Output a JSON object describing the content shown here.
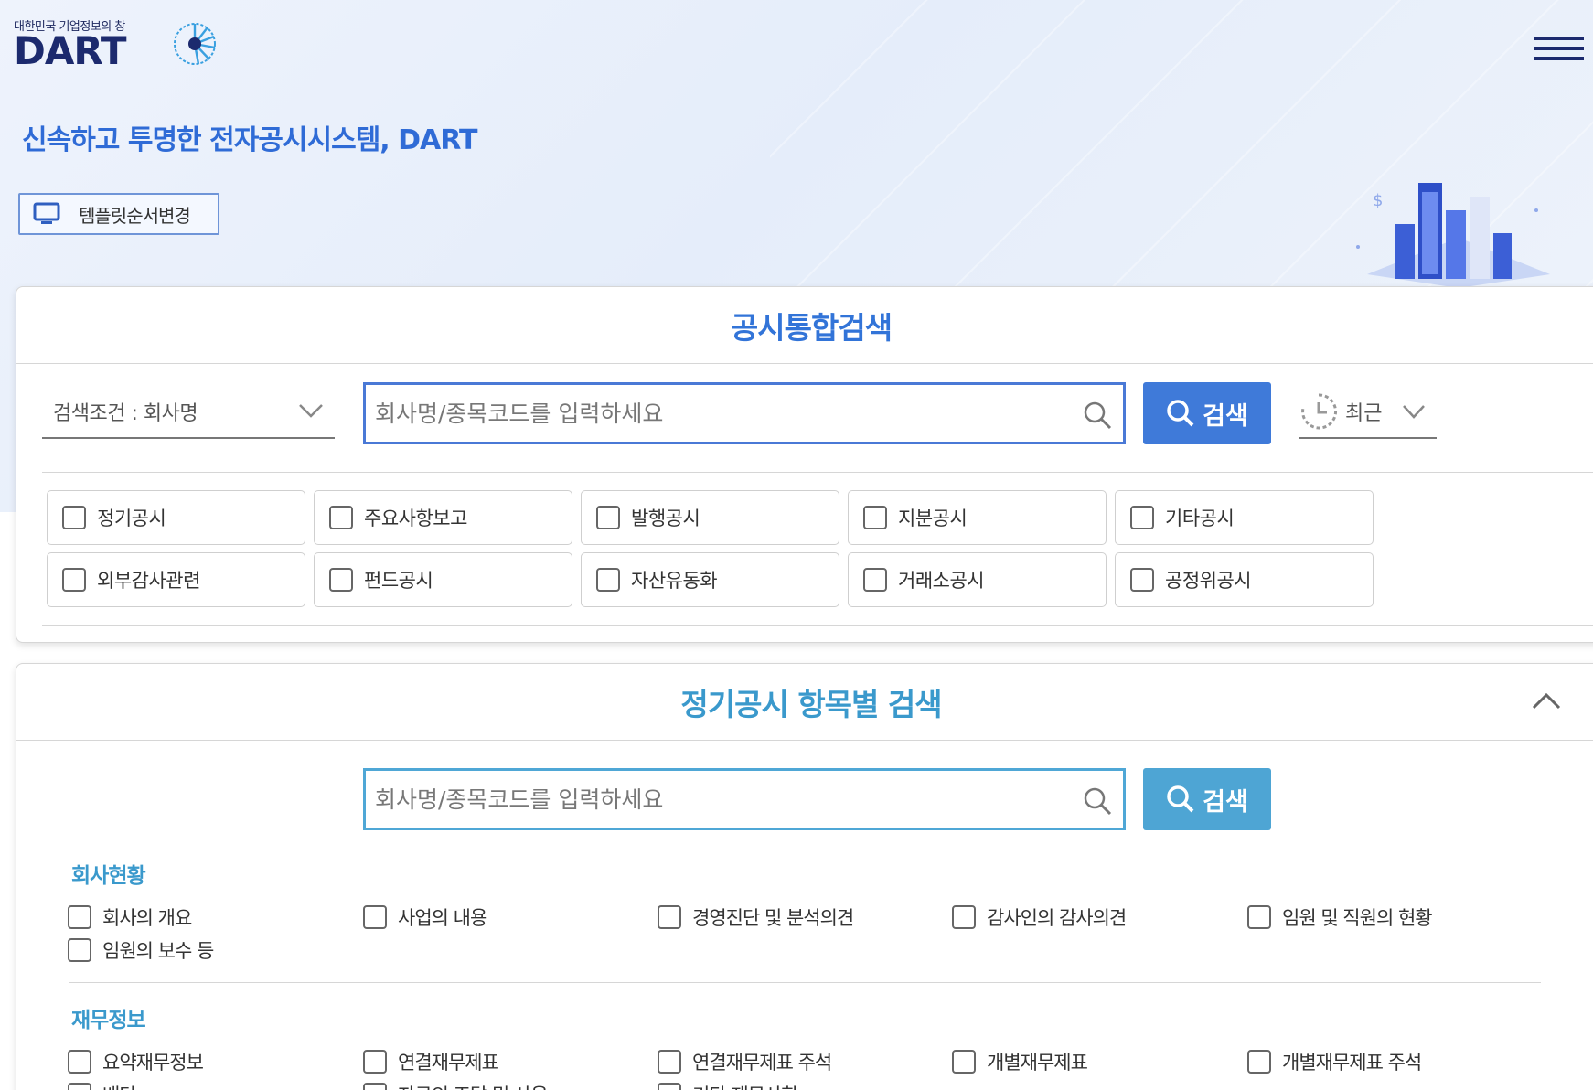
{
  "logo": {
    "subtitle": "대한민국 기업정보의 창",
    "name": "DART"
  },
  "slogan": "신속하고 투명한 전자공시시스템, DART",
  "template_button": "템플릿순서변경",
  "panel1": {
    "title": "공시통합검색",
    "condition": "검색조건 : 회사명",
    "search_placeholder": "회사명/종목코드를 입력하세요",
    "search_button": "검색",
    "recent": "최근",
    "filters": [
      "정기공시",
      "주요사항보고",
      "발행공시",
      "지분공시",
      "기타공시",
      "외부감사관련",
      "펀드공시",
      "자산유동화",
      "거래소공시",
      "공정위공시"
    ]
  },
  "panel2": {
    "title": "정기공시 항목별 검색",
    "search_placeholder": "회사명/종목코드를 입력하세요",
    "search_button": "검색",
    "section1": {
      "title": "회사현황",
      "items": [
        "회사의 개요",
        "사업의 내용",
        "경영진단 및 분석의견",
        "감사인의 감사의견",
        "임원 및 직원의 현황",
        "임원의 보수 등"
      ]
    },
    "section2": {
      "title": "재무정보",
      "items": [
        "요약재무정보",
        "연결재무제표",
        "연결재무제표 주석",
        "개별재무제표",
        "개별재무제표 주석",
        "배당",
        "자금의 조달 및 사용",
        "기타 재무사항"
      ]
    }
  },
  "colors": {
    "brand_navy": "#1c2a6e",
    "primary_blue": "#3f7ad9",
    "sky_blue": "#4ea5d4"
  }
}
